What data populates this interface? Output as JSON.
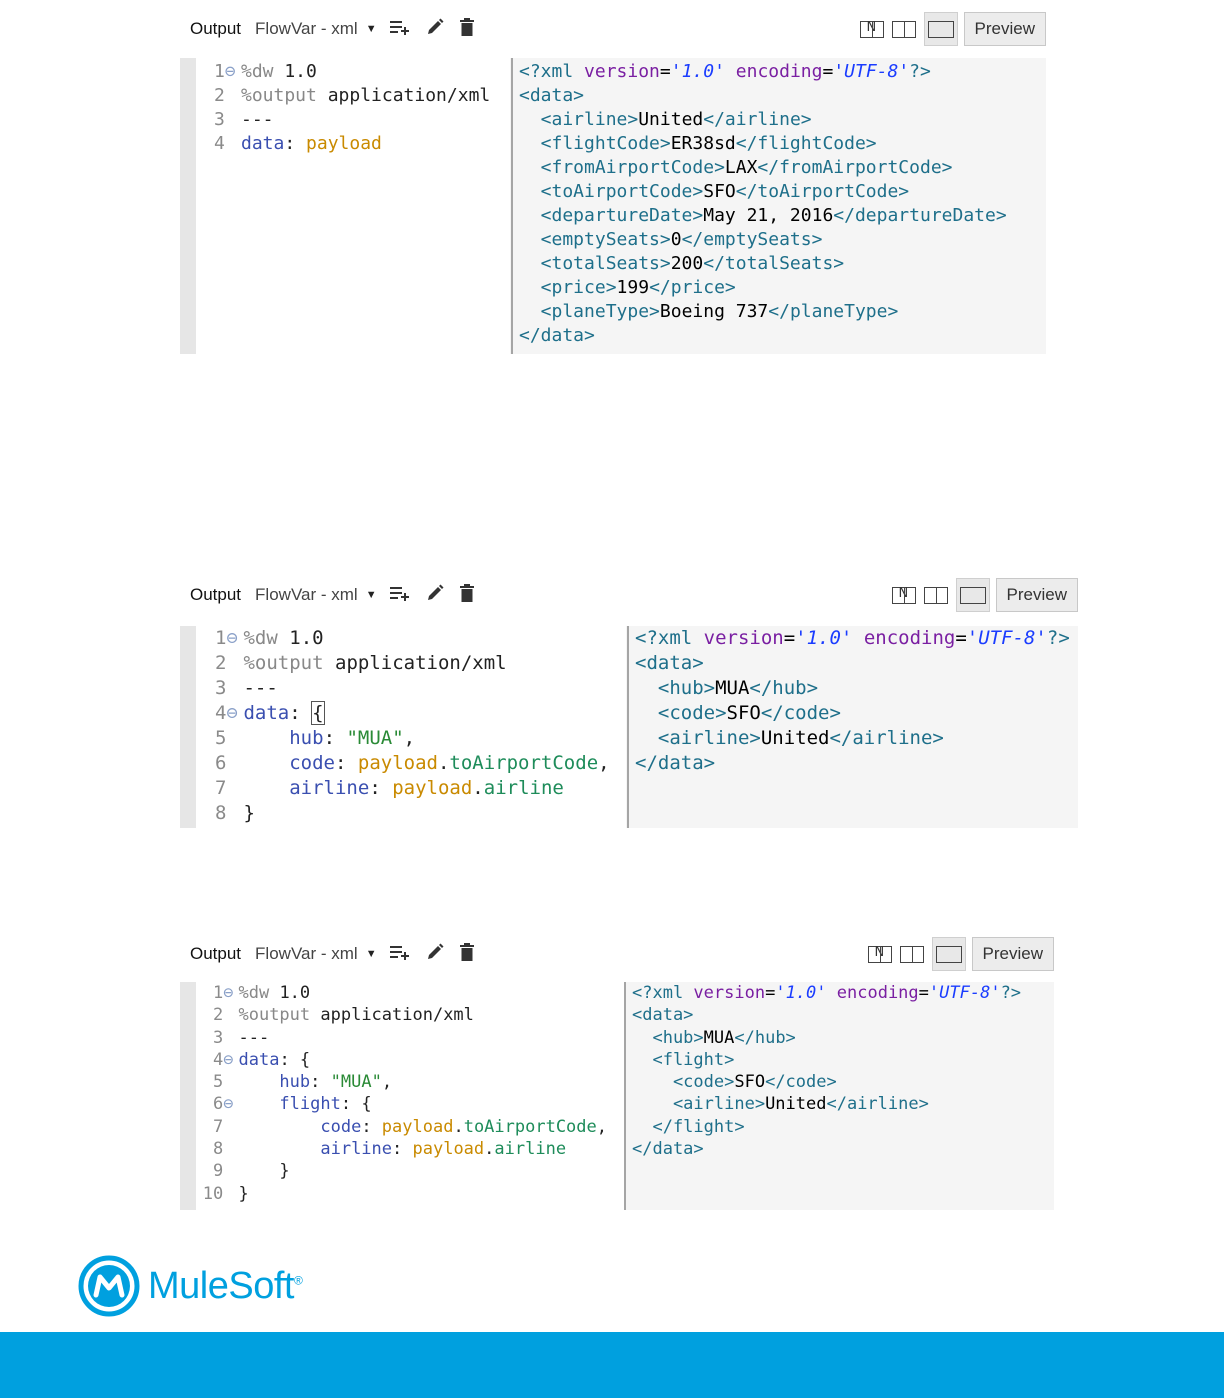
{
  "panels": [
    {
      "toolbar": {
        "output_label": "Output",
        "variable_label": "FlowVar - xml",
        "preview_label": "Preview"
      },
      "script_lines": [
        {
          "n": "1",
          "fold": true,
          "tokens": [
            {
              "t": "%dw ",
              "c": "kw"
            },
            {
              "t": "1.0",
              "c": "plain"
            }
          ]
        },
        {
          "n": "2",
          "fold": false,
          "tokens": [
            {
              "t": "%output ",
              "c": "kw"
            },
            {
              "t": "application/xml",
              "c": "plain"
            }
          ]
        },
        {
          "n": "3",
          "fold": false,
          "tokens": [
            {
              "t": "---",
              "c": "plain"
            }
          ]
        },
        {
          "n": "4",
          "fold": false,
          "tokens": [
            {
              "t": "data",
              "c": "key"
            },
            {
              "t": ": ",
              "c": "plain"
            },
            {
              "t": "payload",
              "c": "pay"
            }
          ]
        }
      ],
      "output_lines": [
        [
          {
            "t": "<?xml ",
            "c": "pi"
          },
          {
            "t": "version",
            "c": "attr"
          },
          {
            "t": "=",
            "c": "txt"
          },
          {
            "t": "'1.0'",
            "c": "val"
          },
          {
            "t": " ",
            "c": "txt"
          },
          {
            "t": "encoding",
            "c": "attr"
          },
          {
            "t": "=",
            "c": "txt"
          },
          {
            "t": "'UTF-8'",
            "c": "val"
          },
          {
            "t": "?>",
            "c": "pi"
          }
        ],
        [
          {
            "t": "<data>",
            "c": "tag"
          }
        ],
        [
          {
            "t": "  <airline>",
            "c": "tag"
          },
          {
            "t": "United",
            "c": "txt"
          },
          {
            "t": "</airline>",
            "c": "tag"
          }
        ],
        [
          {
            "t": "  <flightCode>",
            "c": "tag"
          },
          {
            "t": "ER38sd",
            "c": "txt"
          },
          {
            "t": "</flightCode>",
            "c": "tag"
          }
        ],
        [
          {
            "t": "  <fromAirportCode>",
            "c": "tag"
          },
          {
            "t": "LAX",
            "c": "txt"
          },
          {
            "t": "</fromAirportCode>",
            "c": "tag"
          }
        ],
        [
          {
            "t": "  <toAirportCode>",
            "c": "tag"
          },
          {
            "t": "SFO",
            "c": "txt"
          },
          {
            "t": "</toAirportCode>",
            "c": "tag"
          }
        ],
        [
          {
            "t": "  <departureDate>",
            "c": "tag"
          },
          {
            "t": "May 21, 2016",
            "c": "txt"
          },
          {
            "t": "</departureDate>",
            "c": "tag"
          }
        ],
        [
          {
            "t": "  <emptySeats>",
            "c": "tag"
          },
          {
            "t": "0",
            "c": "txt"
          },
          {
            "t": "</emptySeats>",
            "c": "tag"
          }
        ],
        [
          {
            "t": "  <totalSeats>",
            "c": "tag"
          },
          {
            "t": "200",
            "c": "txt"
          },
          {
            "t": "</totalSeats>",
            "c": "tag"
          }
        ],
        [
          {
            "t": "  <price>",
            "c": "tag"
          },
          {
            "t": "199",
            "c": "txt"
          },
          {
            "t": "</price>",
            "c": "tag"
          }
        ],
        [
          {
            "t": "  <planeType>",
            "c": "tag"
          },
          {
            "t": "Boeing 737",
            "c": "txt"
          },
          {
            "t": "</planeType>",
            "c": "tag"
          }
        ],
        [
          {
            "t": "</data>",
            "c": "tag"
          }
        ]
      ]
    },
    {
      "toolbar": {
        "output_label": "Output",
        "variable_label": "FlowVar - xml",
        "preview_label": "Preview"
      },
      "script_lines": [
        {
          "n": "1",
          "fold": true,
          "tokens": [
            {
              "t": "%dw ",
              "c": "kw"
            },
            {
              "t": "1.0",
              "c": "plain"
            }
          ]
        },
        {
          "n": "2",
          "fold": false,
          "tokens": [
            {
              "t": "%output ",
              "c": "kw"
            },
            {
              "t": "application/xml",
              "c": "plain"
            }
          ]
        },
        {
          "n": "3",
          "fold": false,
          "tokens": [
            {
              "t": "---",
              "c": "plain"
            }
          ]
        },
        {
          "n": "4",
          "fold": true,
          "tokens": [
            {
              "t": "data",
              "c": "key"
            },
            {
              "t": ": ",
              "c": "plain"
            },
            {
              "t": "{",
              "c": "cursor"
            }
          ]
        },
        {
          "n": "5",
          "fold": false,
          "tokens": [
            {
              "t": "    hub",
              "c": "key"
            },
            {
              "t": ": ",
              "c": "plain"
            },
            {
              "t": "\"MUA\"",
              "c": "str"
            },
            {
              "t": ",",
              "c": "plain"
            }
          ]
        },
        {
          "n": "6",
          "fold": false,
          "tokens": [
            {
              "t": "    code",
              "c": "key"
            },
            {
              "t": ": ",
              "c": "plain"
            },
            {
              "t": "payload",
              "c": "pay"
            },
            {
              "t": ".",
              "c": "plain"
            },
            {
              "t": "toAirportCode",
              "c": "field"
            },
            {
              "t": ",",
              "c": "plain"
            }
          ]
        },
        {
          "n": "7",
          "fold": false,
          "tokens": [
            {
              "t": "    airline",
              "c": "key"
            },
            {
              "t": ": ",
              "c": "plain"
            },
            {
              "t": "payload",
              "c": "pay"
            },
            {
              "t": ".",
              "c": "plain"
            },
            {
              "t": "airline",
              "c": "field"
            }
          ]
        },
        {
          "n": "8",
          "fold": false,
          "tokens": [
            {
              "t": "}",
              "c": "plain"
            }
          ]
        }
      ],
      "output_lines": [
        [
          {
            "t": "<?xml ",
            "c": "pi"
          },
          {
            "t": "version",
            "c": "attr"
          },
          {
            "t": "=",
            "c": "txt"
          },
          {
            "t": "'1.0'",
            "c": "val"
          },
          {
            "t": " ",
            "c": "txt"
          },
          {
            "t": "encoding",
            "c": "attr"
          },
          {
            "t": "=",
            "c": "txt"
          },
          {
            "t": "'UTF-8'",
            "c": "val"
          },
          {
            "t": "?>",
            "c": "pi"
          }
        ],
        [
          {
            "t": "<data>",
            "c": "tag"
          }
        ],
        [
          {
            "t": "  <hub>",
            "c": "tag"
          },
          {
            "t": "MUA",
            "c": "txt"
          },
          {
            "t": "</hub>",
            "c": "tag"
          }
        ],
        [
          {
            "t": "  <code>",
            "c": "tag"
          },
          {
            "t": "SFO",
            "c": "txt"
          },
          {
            "t": "</code>",
            "c": "tag"
          }
        ],
        [
          {
            "t": "  <airline>",
            "c": "tag"
          },
          {
            "t": "United",
            "c": "txt"
          },
          {
            "t": "</airline>",
            "c": "tag"
          }
        ],
        [
          {
            "t": "</data>",
            "c": "tag"
          }
        ]
      ]
    },
    {
      "toolbar": {
        "output_label": "Output",
        "variable_label": "FlowVar - xml",
        "preview_label": "Preview"
      },
      "script_lines": [
        {
          "n": "1",
          "fold": true,
          "tokens": [
            {
              "t": "%dw ",
              "c": "kw"
            },
            {
              "t": "1.0",
              "c": "plain"
            }
          ]
        },
        {
          "n": "2",
          "fold": false,
          "tokens": [
            {
              "t": "%output ",
              "c": "kw"
            },
            {
              "t": "application/xml",
              "c": "plain"
            }
          ]
        },
        {
          "n": "3",
          "fold": false,
          "tokens": [
            {
              "t": "---",
              "c": "plain"
            }
          ]
        },
        {
          "n": "4",
          "fold": true,
          "tokens": [
            {
              "t": "data",
              "c": "key"
            },
            {
              "t": ": {",
              "c": "plain"
            }
          ]
        },
        {
          "n": "5",
          "fold": false,
          "tokens": [
            {
              "t": "    hub",
              "c": "key"
            },
            {
              "t": ": ",
              "c": "plain"
            },
            {
              "t": "\"MUA\"",
              "c": "str"
            },
            {
              "t": ",",
              "c": "plain"
            }
          ]
        },
        {
          "n": "6",
          "fold": true,
          "tokens": [
            {
              "t": "    flight",
              "c": "key"
            },
            {
              "t": ": {",
              "c": "plain"
            }
          ]
        },
        {
          "n": "7",
          "fold": false,
          "tokens": [
            {
              "t": "        code",
              "c": "key"
            },
            {
              "t": ": ",
              "c": "plain"
            },
            {
              "t": "payload",
              "c": "pay"
            },
            {
              "t": ".",
              "c": "plain"
            },
            {
              "t": "toAirportCode",
              "c": "field"
            },
            {
              "t": ",",
              "c": "plain"
            }
          ]
        },
        {
          "n": "8",
          "fold": false,
          "tokens": [
            {
              "t": "        airline",
              "c": "key"
            },
            {
              "t": ": ",
              "c": "plain"
            },
            {
              "t": "payload",
              "c": "pay"
            },
            {
              "t": ".",
              "c": "plain"
            },
            {
              "t": "airline",
              "c": "field"
            }
          ]
        },
        {
          "n": "9",
          "fold": false,
          "tokens": [
            {
              "t": "    }",
              "c": "plain"
            }
          ]
        },
        {
          "n": "10",
          "fold": false,
          "tokens": [
            {
              "t": "}",
              "c": "plain"
            }
          ]
        }
      ],
      "output_lines": [
        [
          {
            "t": "<?xml ",
            "c": "pi"
          },
          {
            "t": "version",
            "c": "attr"
          },
          {
            "t": "=",
            "c": "txt"
          },
          {
            "t": "'1.0'",
            "c": "val"
          },
          {
            "t": " ",
            "c": "txt"
          },
          {
            "t": "encoding",
            "c": "attr"
          },
          {
            "t": "=",
            "c": "txt"
          },
          {
            "t": "'UTF-8'",
            "c": "val"
          },
          {
            "t": "?>",
            "c": "pi"
          }
        ],
        [
          {
            "t": "<data>",
            "c": "tag"
          }
        ],
        [
          {
            "t": "  <hub>",
            "c": "tag"
          },
          {
            "t": "MUA",
            "c": "txt"
          },
          {
            "t": "</hub>",
            "c": "tag"
          }
        ],
        [
          {
            "t": "  <flight>",
            "c": "tag"
          }
        ],
        [
          {
            "t": "    <code>",
            "c": "tag"
          },
          {
            "t": "SFO",
            "c": "txt"
          },
          {
            "t": "</code>",
            "c": "tag"
          }
        ],
        [
          {
            "t": "    <airline>",
            "c": "tag"
          },
          {
            "t": "United",
            "c": "txt"
          },
          {
            "t": "</airline>",
            "c": "tag"
          }
        ],
        [
          {
            "t": "  </flight>",
            "c": "tag"
          }
        ],
        [
          {
            "t": "</data>",
            "c": "tag"
          }
        ]
      ]
    }
  ],
  "brand": {
    "name": "MuleSoft",
    "trademark": "®",
    "color": "#00a0df"
  }
}
